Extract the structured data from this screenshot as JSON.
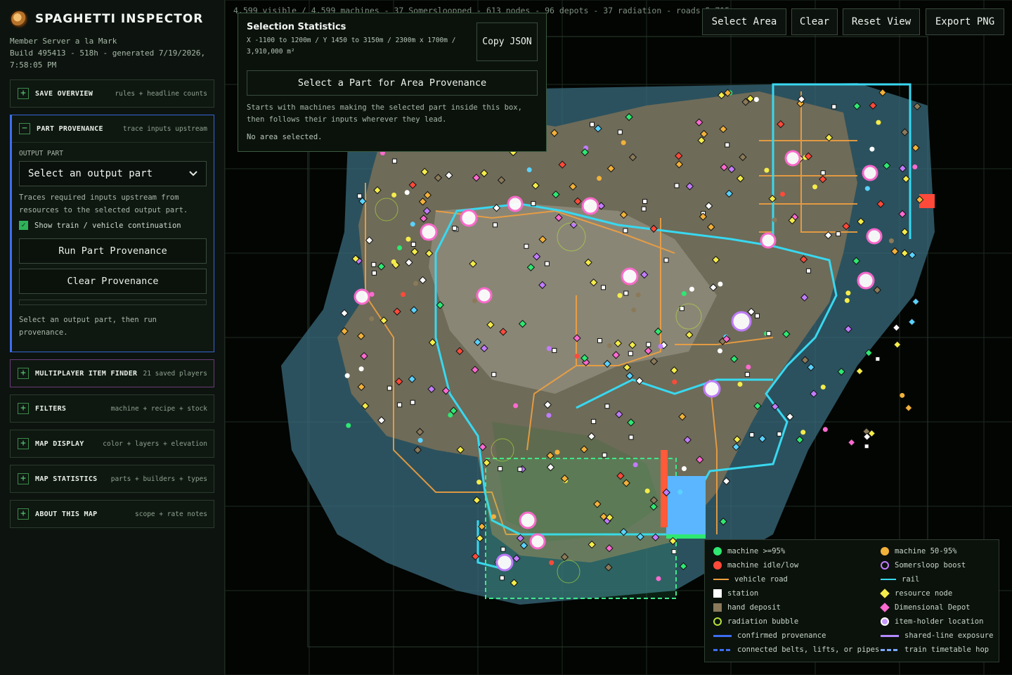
{
  "app": {
    "title": "SPAGHETTI INSPECTOR",
    "server": "Member Server a la Mark",
    "build": "Build 495413 - 518h - generated 7/19/2026, 7:58:05 PM"
  },
  "panels": {
    "save_overview": {
      "icon": "+",
      "title": "SAVE OVERVIEW",
      "sub": "rules + headline counts"
    },
    "part_provenance": {
      "icon": "−",
      "title": "PART PROVENANCE",
      "sub": "trace inputs upstream",
      "output_label": "OUTPUT PART",
      "select_value": "Select an output part",
      "help": "Traces required inputs upstream from resources to the selected output part.",
      "checkbox_label": "Show train / vehicle continuation",
      "run_label": "Run Part Provenance",
      "clear_label": "Clear Provenance",
      "status": "Select an output part, then run provenance."
    },
    "multiplayer": {
      "icon": "+",
      "title": "MULTIPLAYER ITEM FINDER",
      "sub": "21 saved players"
    },
    "filters": {
      "icon": "+",
      "title": "FILTERS",
      "sub": "machine + recipe + stock"
    },
    "map_display": {
      "icon": "+",
      "title": "MAP DISPLAY",
      "sub": "color + layers + elevation"
    },
    "map_statistics": {
      "icon": "+",
      "title": "MAP STATISTICS",
      "sub": "parts + builders + types"
    },
    "about": {
      "icon": "+",
      "title": "ABOUT THIS MAP",
      "sub": "scope + rate notes"
    }
  },
  "map": {
    "stats_line": "4,599 visible / 4,599 machines - 37 Somersloopped - 613 nodes - 96 depots - 37 radiation - roads 5,715"
  },
  "toolbar": {
    "select_area": "Select Area",
    "clear": "Clear",
    "reset_view": "Reset View",
    "export_png": "Export PNG"
  },
  "selection": {
    "title": "Selection Statistics",
    "coords": "X -1100 to 1200m / Y 1450 to 3150m / 2300m x 1700m / 3,910,000 m²",
    "copy_label": "Copy JSON",
    "area_button": "Select a Part for Area Provenance",
    "description": "Starts with machines making the selected part inside this box, then follows their inputs wherever they lead.",
    "status": "No area selected."
  },
  "legend": [
    {
      "label": "machine >=95%",
      "kind": "dot",
      "color": "#2ee872"
    },
    {
      "label": "machine 50-95%",
      "kind": "dot",
      "color": "#f2b13a"
    },
    {
      "label": "machine idle/low",
      "kind": "dot",
      "color": "#ff4a3a"
    },
    {
      "label": "Somersloop boost",
      "kind": "ring",
      "color": "#c27cff"
    },
    {
      "label": "vehicle road",
      "kind": "line",
      "color": "#f0a040"
    },
    {
      "label": "rail",
      "kind": "line",
      "color": "#38d8f0"
    },
    {
      "label": "station",
      "kind": "square",
      "color": "#ffffff"
    },
    {
      "label": "resource node",
      "kind": "diamond",
      "color": "#f4ec4a"
    },
    {
      "label": "hand deposit",
      "kind": "square",
      "color": "#8a7a5a"
    },
    {
      "label": "Dimensional Depot",
      "kind": "diamond",
      "color": "#ff6ad0"
    },
    {
      "label": "radiation bubble",
      "kind": "ring",
      "color": "#b6e23a"
    },
    {
      "label": "item-holder location",
      "kind": "ringfill",
      "color": "#c79aff"
    },
    {
      "label": "confirmed provenance",
      "kind": "thick",
      "color": "#3d6ef0"
    },
    {
      "label": "shared-line exposure",
      "kind": "thick",
      "color": "#b48aff"
    },
    {
      "label": "connected belts, lifts, or pipes",
      "kind": "dash",
      "color": "#3d6ef0"
    },
    {
      "label": "train timetable hop",
      "kind": "dash",
      "color": "#7aa8ff"
    }
  ]
}
